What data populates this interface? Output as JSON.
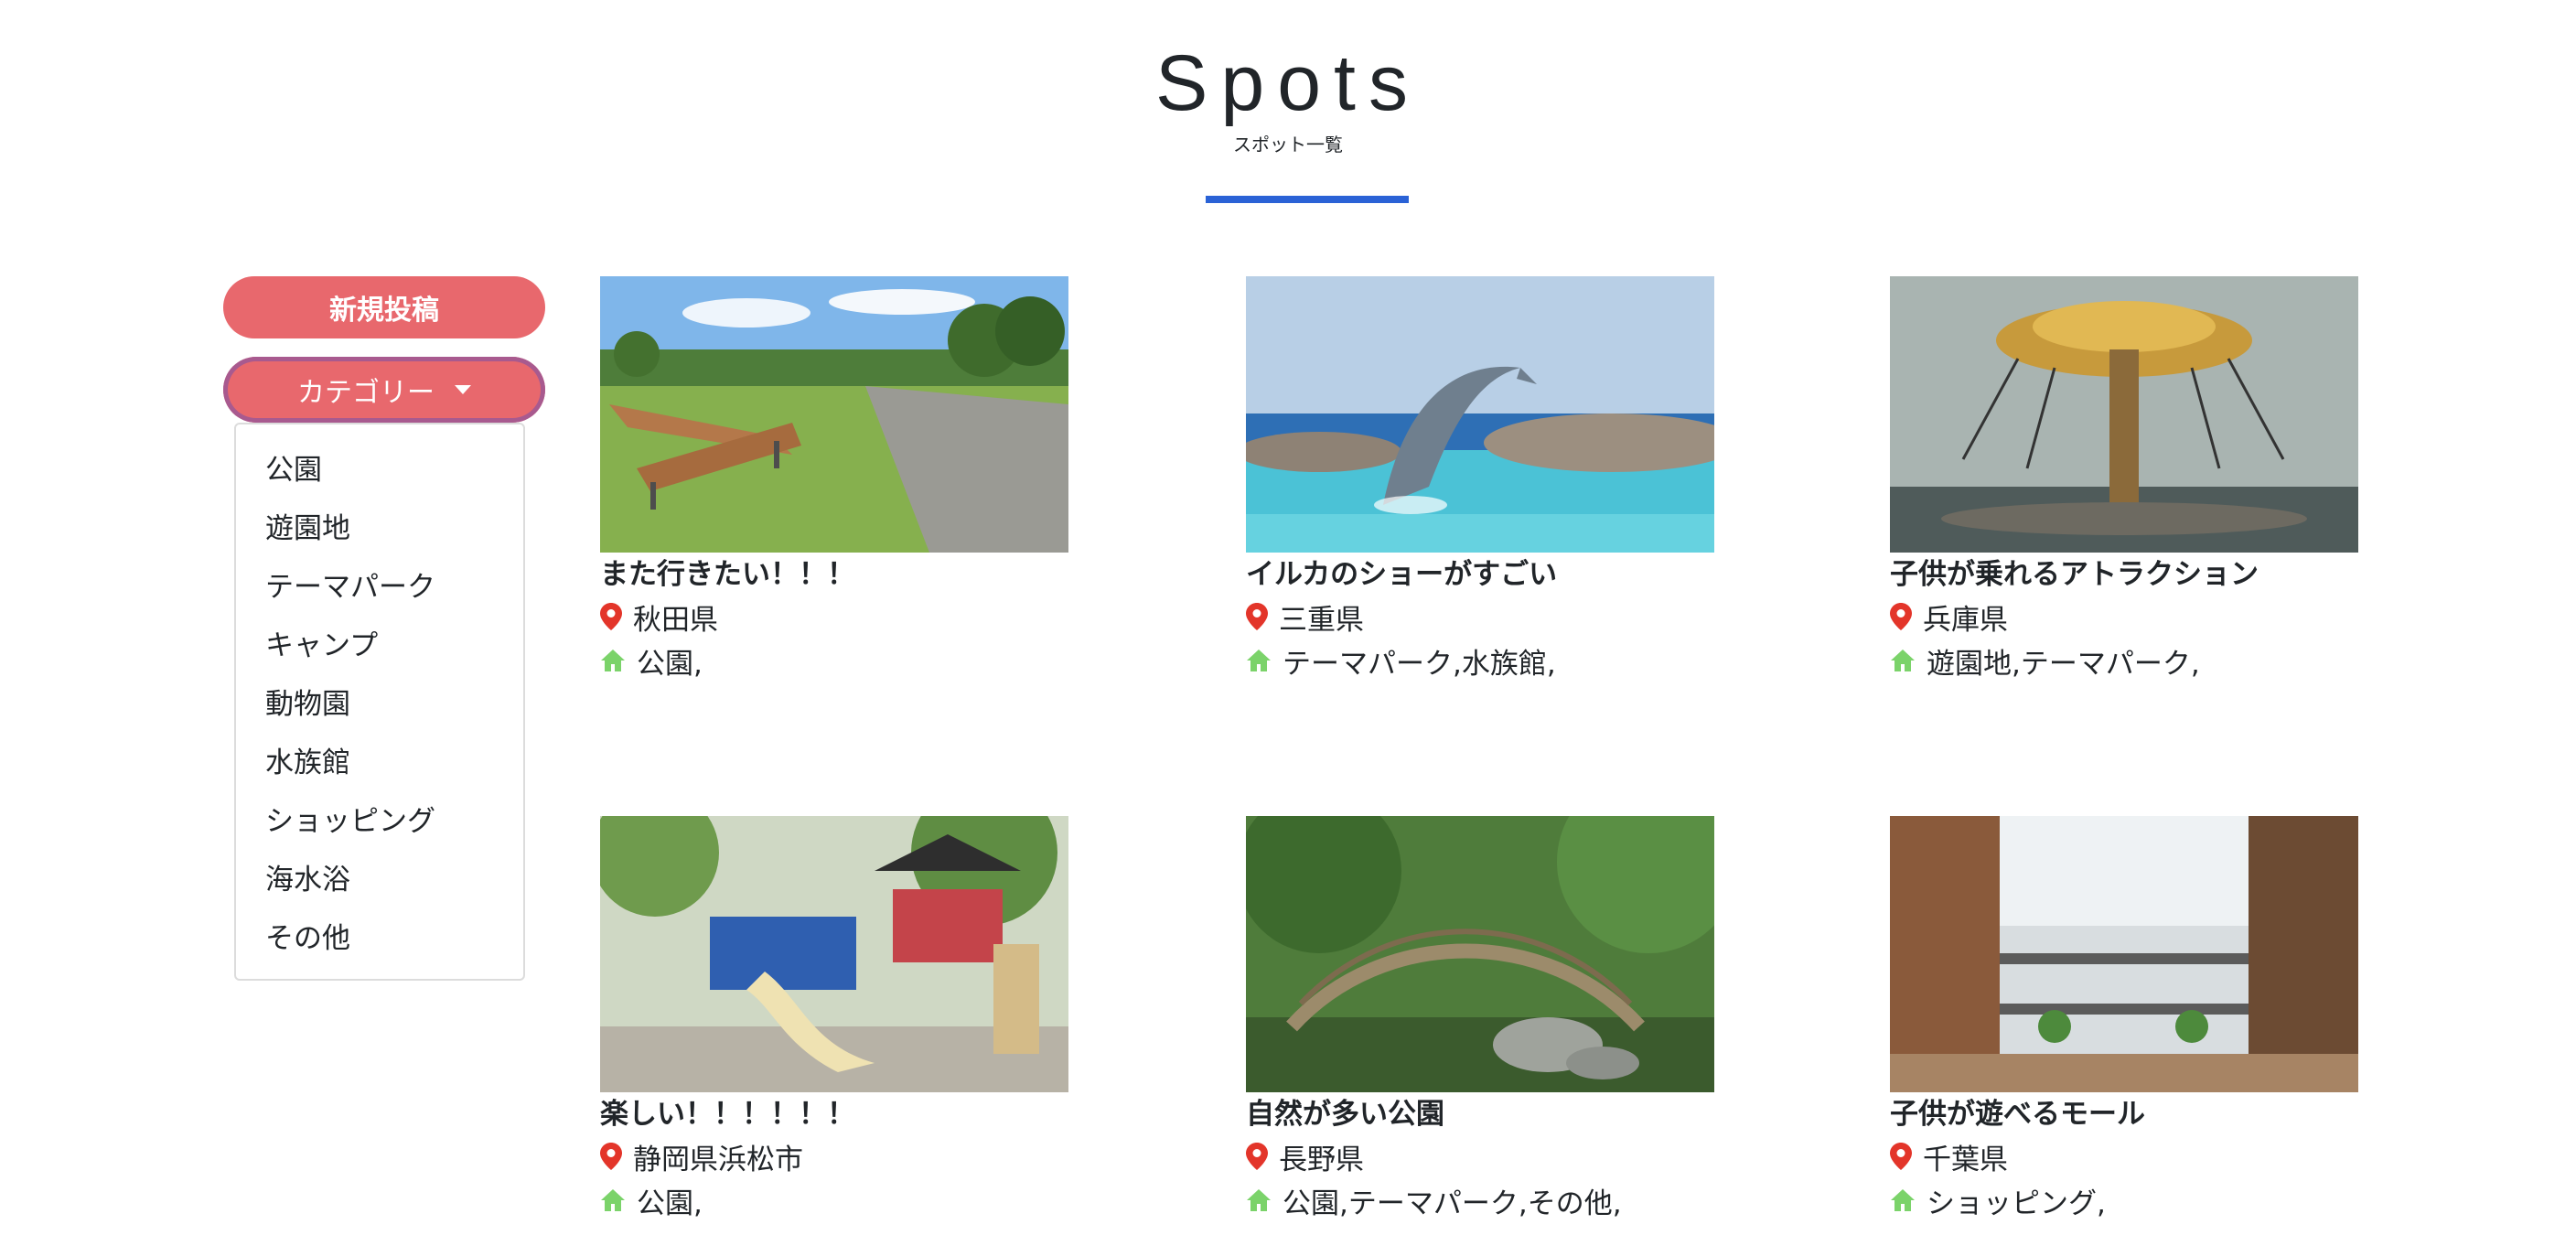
{
  "header": {
    "title": "Spots",
    "subtitle": "スポット一覧"
  },
  "sidebar": {
    "new_post_label": "新規投稿",
    "category_label": "カテゴリー",
    "categories": [
      "公園",
      "遊園地",
      "テーマパーク",
      "キャンプ",
      "動物園",
      "水族館",
      "ショッピング",
      "海水浴",
      "その他"
    ]
  },
  "icons": {
    "location": "location-pin-icon",
    "category": "home-icon"
  },
  "colors": {
    "brand": "#e8686d",
    "accent_blue": "#2a62d6",
    "pin": "#e3352a",
    "home": "#7bd36a"
  },
  "spots": [
    {
      "title": "また行きたい！！！",
      "prefecture": "秋田県",
      "categories": "公園,",
      "image": "park-bench"
    },
    {
      "title": "イルカのショーがすごい",
      "prefecture": "三重県",
      "categories": "テーマパーク,水族館,",
      "image": "dolphin"
    },
    {
      "title": "子供が乗れるアトラクション",
      "prefecture": "兵庫県",
      "categories": "遊園地,テーマパーク,",
      "image": "swing-ride"
    },
    {
      "title": "楽しい！！！！！！",
      "prefecture": "静岡県浜松市",
      "categories": "公園,",
      "image": "playground"
    },
    {
      "title": "自然が多い公園",
      "prefecture": "長野県",
      "categories": "公園,テーマパーク,その他,",
      "image": "garden-bridge"
    },
    {
      "title": "子供が遊べるモール",
      "prefecture": "千葉県",
      "categories": "ショッピング,",
      "image": "shopping-mall"
    }
  ]
}
